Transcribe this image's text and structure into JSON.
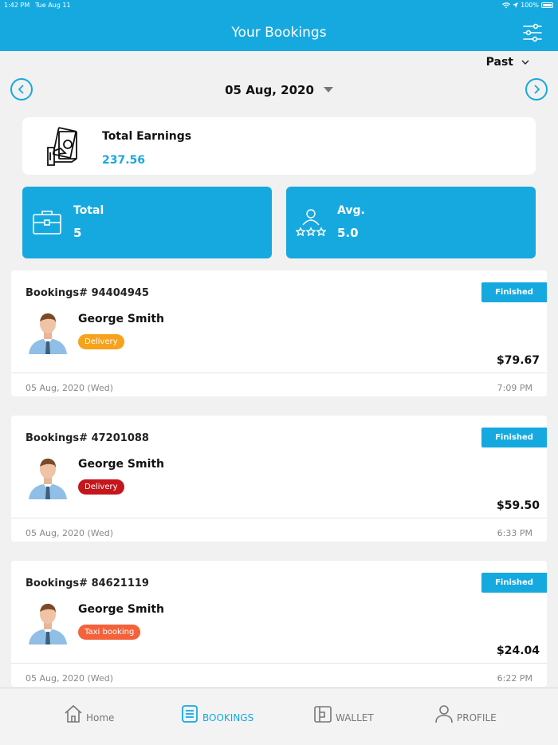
{
  "status_bar": {
    "time": "1:42 PM",
    "date": "Tue Aug 11",
    "battery": "100%"
  },
  "header": {
    "title": "Your Bookings"
  },
  "filter": {
    "period": "Past",
    "date": "05 Aug, 2020"
  },
  "earnings": {
    "label": "Total Earnings",
    "value": "237.56"
  },
  "stats": {
    "total": {
      "label": "Total",
      "value": "5"
    },
    "avg": {
      "label": "Avg.",
      "value": "5.0"
    }
  },
  "bookings": [
    {
      "id": "Bookings# 94404945",
      "status": "Finished",
      "name": "George Smith",
      "tag": "Delivery",
      "tag_color": "#f7a21b",
      "amount": "$79.67",
      "date": "05 Aug, 2020 (Wed)",
      "time": "7:09 PM"
    },
    {
      "id": "Bookings# 47201088",
      "status": "Finished",
      "name": "George Smith",
      "tag": "Delivery",
      "tag_color": "#c4161c",
      "amount": "$59.50",
      "date": "05 Aug, 2020 (Wed)",
      "time": "6:33 PM"
    },
    {
      "id": "Bookings# 84621119",
      "status": "Finished",
      "name": "George Smith",
      "tag": "Taxi booking",
      "tag_color": "#f4623a",
      "amount": "$24.04",
      "date": "05 Aug, 2020 (Wed)",
      "time": "6:22 PM"
    }
  ],
  "tabs": {
    "home": "Home",
    "bookings": "BOOKINGS",
    "wallet": "WALLET",
    "profile": "PROFILE"
  },
  "colors": {
    "accent": "#16a9df",
    "background": "#f1f1f1"
  },
  "icons": [
    "filter-sliders-icon",
    "chevron-down-icon",
    "chevron-left-icon",
    "chevron-right-icon",
    "money-hand-icon",
    "briefcase-icon",
    "rating-person-icon",
    "home-icon",
    "bookings-list-icon",
    "wallet-icon",
    "profile-icon"
  ]
}
